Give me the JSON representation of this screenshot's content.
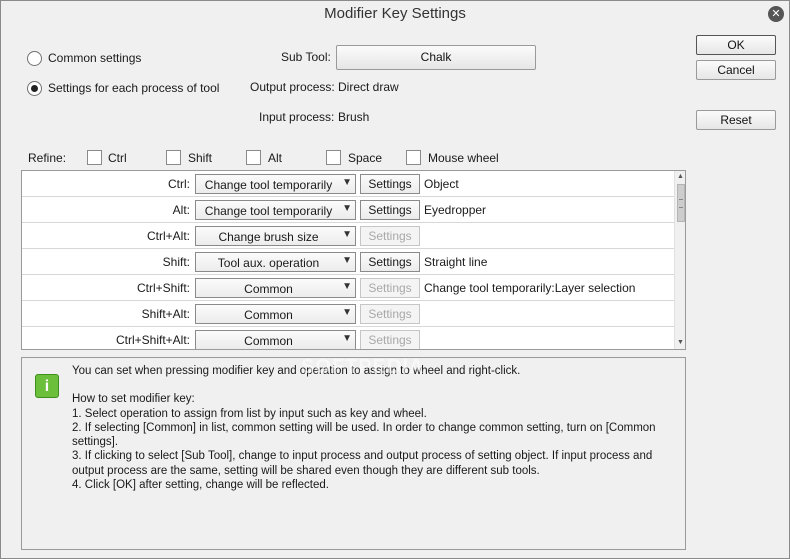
{
  "window": {
    "title": "Modifier Key Settings"
  },
  "mode": {
    "common_label": "Common settings",
    "per_tool_label": "Settings for each process of tool",
    "selected": "per_tool"
  },
  "tool": {
    "subtool_label": "Sub Tool:",
    "subtool_value": "Chalk",
    "output_label": "Output process:",
    "output_value": "Direct draw",
    "input_label": "Input process:",
    "input_value": "Brush"
  },
  "buttons": {
    "ok": "OK",
    "cancel": "Cancel",
    "reset": "Reset"
  },
  "refine": {
    "label": "Refine:",
    "options": [
      "Ctrl",
      "Shift",
      "Alt",
      "Space",
      "Mouse wheel"
    ]
  },
  "grid": {
    "settings_label": "Settings",
    "rows": [
      {
        "key": "Ctrl:",
        "operation": "Change tool temporarily",
        "settings_enabled": true,
        "target": "Object"
      },
      {
        "key": "Alt:",
        "operation": "Change tool temporarily",
        "settings_enabled": true,
        "target": "Eyedropper"
      },
      {
        "key": "Ctrl+Alt:",
        "operation": "Change brush size",
        "settings_enabled": false,
        "target": ""
      },
      {
        "key": "Shift:",
        "operation": "Tool aux. operation",
        "settings_enabled": true,
        "target": "Straight line"
      },
      {
        "key": "Ctrl+Shift:",
        "operation": "Common",
        "settings_enabled": false,
        "target": "Change tool temporarily:Layer selection"
      },
      {
        "key": "Shift+Alt:",
        "operation": "Common",
        "settings_enabled": false,
        "target": ""
      },
      {
        "key": "Ctrl+Shift+Alt:",
        "operation": "Common",
        "settings_enabled": false,
        "target": ""
      }
    ]
  },
  "info": {
    "intro": "You can set when pressing modifier key and operation to assign to wheel and right-click.",
    "heading": "How to set modifier key:",
    "steps": [
      "1. Select operation to assign from list by input such as key and wheel.",
      "2. If selecting [Common] in list, common setting will be used. In order to change common setting, turn on [Common settings].",
      "3. If clicking to select [Sub Tool], change to input process and output process of setting object. If input process and output process are the same, setting will be shared even though they are different sub tools.",
      "4. Click [OK] after setting, change will be reflected."
    ]
  },
  "watermark": "SOFTPEDIA",
  "icons": {
    "close": "close-icon",
    "info": "info-icon",
    "dropdown": "chevron-down-icon"
  }
}
